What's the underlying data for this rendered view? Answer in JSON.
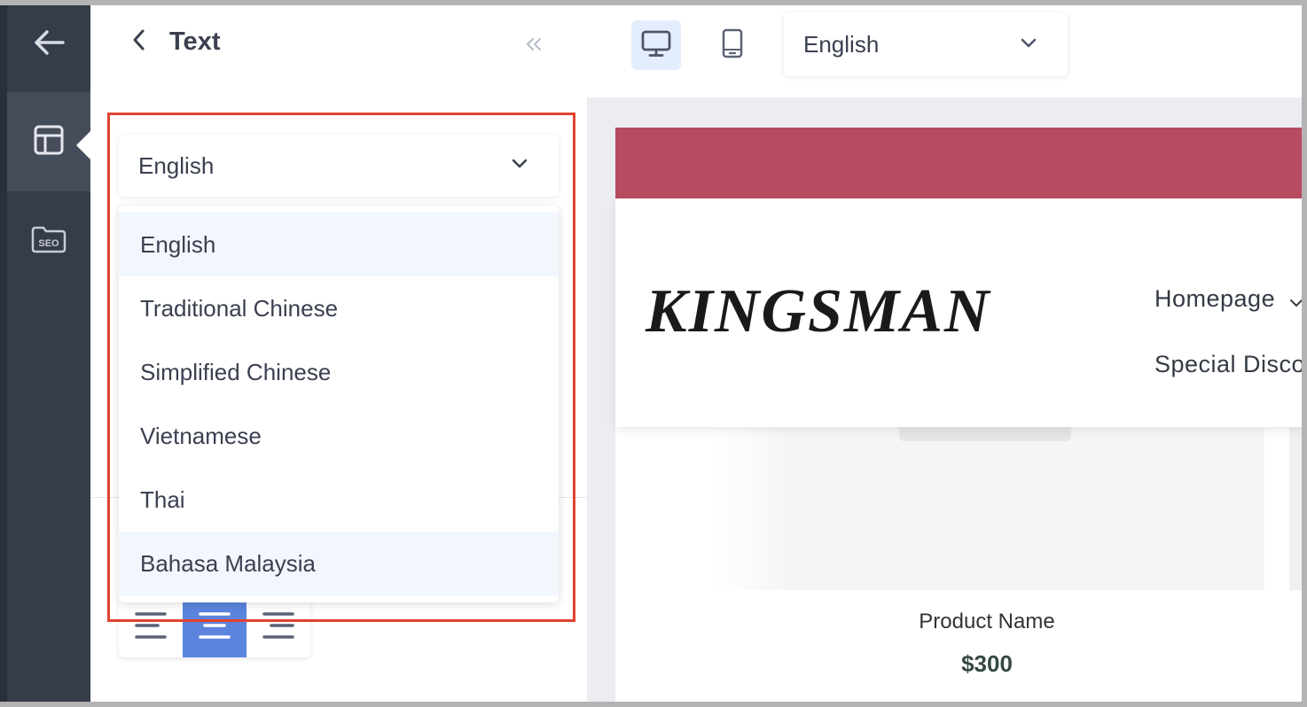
{
  "rail": {
    "items": [
      {
        "icon": "arrow-left-icon"
      },
      {
        "icon": "layout-icon",
        "active": true
      },
      {
        "icon": "seo-folder-icon",
        "label": "SEO"
      }
    ]
  },
  "panel": {
    "title": "Text",
    "language_select": {
      "value": "English",
      "options": [
        "English",
        "Traditional Chinese",
        "Simplified Chinese",
        "Vietnamese",
        "Thai",
        "Bahasa Malaysia"
      ],
      "highlighted": [
        "English",
        "Bahasa Malaysia"
      ]
    },
    "alignment": {
      "options": [
        "left",
        "center",
        "right"
      ],
      "selected": "center"
    }
  },
  "toolbar": {
    "devices": [
      {
        "icon": "desktop-icon",
        "active": true
      },
      {
        "icon": "mobile-icon",
        "active": false
      }
    ],
    "language": "English"
  },
  "preview": {
    "banner_color": "#b74b5f",
    "logo": "KINGSMAN",
    "nav": [
      "Homepage",
      "Special Disco"
    ],
    "product": {
      "name": "Product Name",
      "price": "$300"
    }
  },
  "colors": {
    "rail": "#353c4a",
    "accent": "#5b84de",
    "highlight_border": "#e2432f"
  }
}
